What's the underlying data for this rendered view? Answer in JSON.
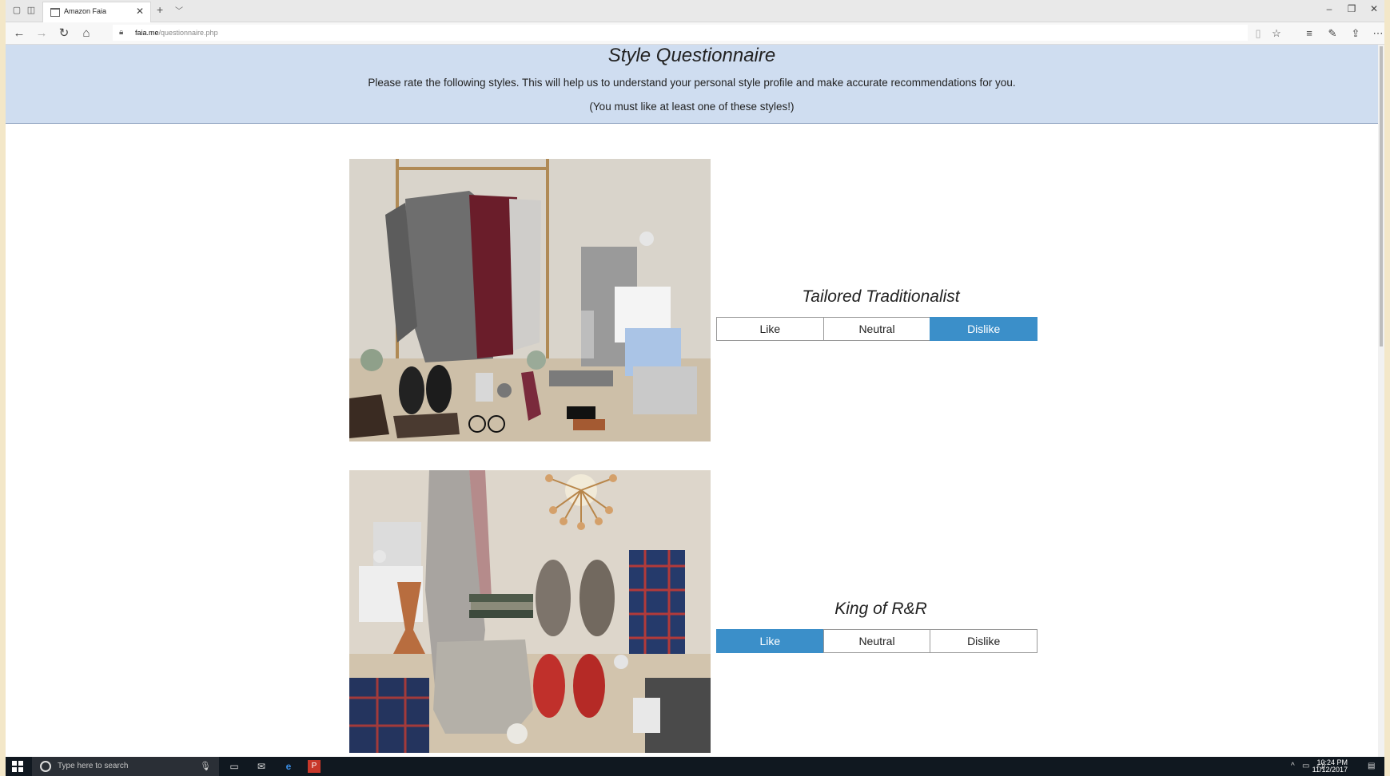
{
  "browser": {
    "tab_title": "Amazon Faia",
    "url_host": "faia.me",
    "url_path": "/questionnaire.php"
  },
  "page": {
    "title": "Style Questionnaire",
    "subtitle": "Please rate the following styles. This will help us to understand your personal style profile and make accurate recommendations for you.",
    "note": "(You must like at least one of these styles!)"
  },
  "styles": [
    {
      "name": "Tailored Traditionalist",
      "options": [
        "Like",
        "Neutral",
        "Dislike"
      ],
      "selected": "Dislike"
    },
    {
      "name": "King of R&R",
      "options": [
        "Like",
        "Neutral",
        "Dislike"
      ],
      "selected": "Like"
    }
  ],
  "taskbar": {
    "search_placeholder": "Type here to search",
    "time": "10:24 PM",
    "date": "11/12/2017"
  },
  "colors": {
    "header_band": "#cfddf0",
    "selected_button": "#3b8fc9",
    "taskbar": "#101820"
  }
}
